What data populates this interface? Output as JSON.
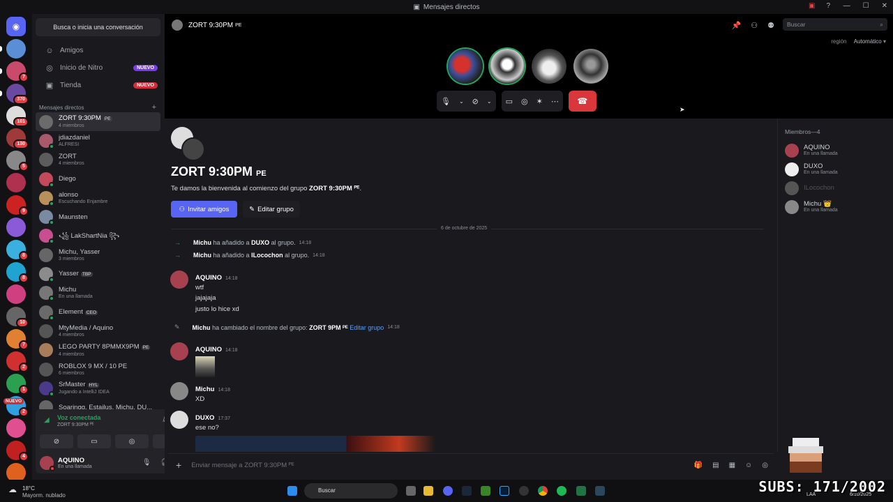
{
  "titlebar": {
    "title": "Mensajes directos"
  },
  "guild_badges": [
    "",
    "",
    "7",
    "370",
    "101",
    "130",
    "5",
    "",
    "9",
    "",
    "8",
    "8",
    "",
    "10",
    "7",
    "2",
    "1",
    "2",
    "",
    "4"
  ],
  "sidebar": {
    "search": "Busca o inicia una conversación",
    "nav": [
      {
        "label": "Amigos",
        "badge": ""
      },
      {
        "label": "Inicio de Nitro",
        "badge": "NUEVO"
      },
      {
        "label": "Tienda",
        "badge": "NUEVO"
      }
    ],
    "dm_header": "Mensajes directos",
    "dms": [
      {
        "name": "ZORT 9:30PM",
        "tag": "PE",
        "sub": "4 miembros",
        "color": "#6b6b6b"
      },
      {
        "name": "jdiazdaniel",
        "tag": "",
        "sub": "ALFRESI",
        "color": "#a8596b"
      },
      {
        "name": "ZORT",
        "tag": "",
        "sub": "4 miembros",
        "color": "#5c5c5c"
      },
      {
        "name": "Diego",
        "tag": "",
        "sub": "",
        "color": "#c24a5c"
      },
      {
        "name": "alonso",
        "tag": "",
        "sub": "Escuchando Enjambre",
        "color": "#b8905a"
      },
      {
        "name": "Maunsten",
        "tag": "",
        "sub": "",
        "color": "#7a8aa0"
      },
      {
        "name": "꧁ LakShartNia ꧂",
        "tag": "",
        "sub": "",
        "color": "#c84f8f"
      },
      {
        "name": "Michu, Yasser",
        "tag": "",
        "sub": "3 miembros",
        "color": "#666"
      },
      {
        "name": "Yasser",
        "tag": "TBP",
        "sub": "",
        "color": "#8b8b8b"
      },
      {
        "name": "Michu",
        "tag": "",
        "sub": "En una llamada",
        "color": "#777"
      },
      {
        "name": "Element",
        "tag": "CEO",
        "sub": "",
        "color": "#6a6a6a"
      },
      {
        "name": "MtyMedia / Aquino",
        "tag": "",
        "sub": "4 miembros",
        "color": "#555"
      },
      {
        "name": "LEGO PARTY 8PMMX9PM",
        "tag": "PE",
        "sub": "4 miembros",
        "color": "#a97d5a"
      },
      {
        "name": "ROBLOX 9 MX / 10 PE",
        "tag": "",
        "sub": "6 miembros",
        "color": "#555"
      },
      {
        "name": "SrMaster",
        "tag": "HYL",
        "sub": "Jugando a IntelliJ IDEA",
        "color": "#4b3a8a"
      },
      {
        "name": "Soaringg, Estailus, Michu, DU...",
        "tag": "",
        "sub": "",
        "color": "#666"
      }
    ]
  },
  "voice": {
    "title": "Voz conectada",
    "channel": "ZORT 9:30PM ᴾᴱ",
    "user": "AQUINO",
    "status": "En una llamada"
  },
  "header": {
    "channel": "ZORT 9:30PM",
    "tag": "PE",
    "search": "Buscar",
    "region": "región",
    "region_value": "Automático"
  },
  "chat": {
    "title": "ZORT 9:30PM",
    "title_tag": "PE",
    "welcome_pre": "Te damos la bienvenida al comienzo del grupo ",
    "welcome_group": "ZORT 9:30PM ᴾᴱ",
    "invite": "Invitar amigos",
    "edit": "Editar grupo",
    "date": "6 de octubre de 2025",
    "sys1": {
      "actor": "Michu",
      "text": "ha añadido a",
      "target": "DUXO",
      "suffix": "al grupo.",
      "time": "14:18"
    },
    "sys2": {
      "actor": "Michu",
      "text": "ha añadido a",
      "target": "ILocochon",
      "suffix": "al grupo.",
      "time": "14:18"
    },
    "m1": {
      "user": "AQUINO",
      "time": "14:18",
      "lines": [
        "wtf",
        "jajajaja",
        "justo lo hice xd"
      ]
    },
    "sys3": {
      "actor": "Michu",
      "text": "ha cambiado el nombre del grupo:",
      "target": "ZORT 9PM ᴾᴱ",
      "link": "Editar grupo",
      "time": "14:18"
    },
    "m2": {
      "user": "AQUINO",
      "time": "14:18"
    },
    "m3": {
      "user": "Michu",
      "time": "14:18",
      "lines": [
        "XD"
      ]
    },
    "m4": {
      "user": "DUXO",
      "time": "17:37",
      "lines": [
        "ese no?"
      ]
    },
    "input_placeholder": "Enviar mensaje a ZORT 9:30PM ᴾᴱ"
  },
  "members": {
    "title": "Miembros—4",
    "list": [
      {
        "name": "AQUINO",
        "status": "En una llamada",
        "color": "#a8414f"
      },
      {
        "name": "DUXO",
        "status": "En una llamada",
        "color": "#eee"
      },
      {
        "name": "ILocochon",
        "status": "",
        "color": "#555"
      },
      {
        "name": "Michu 👑",
        "status": "En una llamada",
        "color": "#888"
      }
    ]
  },
  "taskbar": {
    "weather_temp": "18°C",
    "weather_desc": "Mayorm. nublado",
    "search": "Buscar",
    "lang": "LAA",
    "date": "6/10/2025"
  },
  "overlay": {
    "subs": "SUBS: 171/2002"
  }
}
